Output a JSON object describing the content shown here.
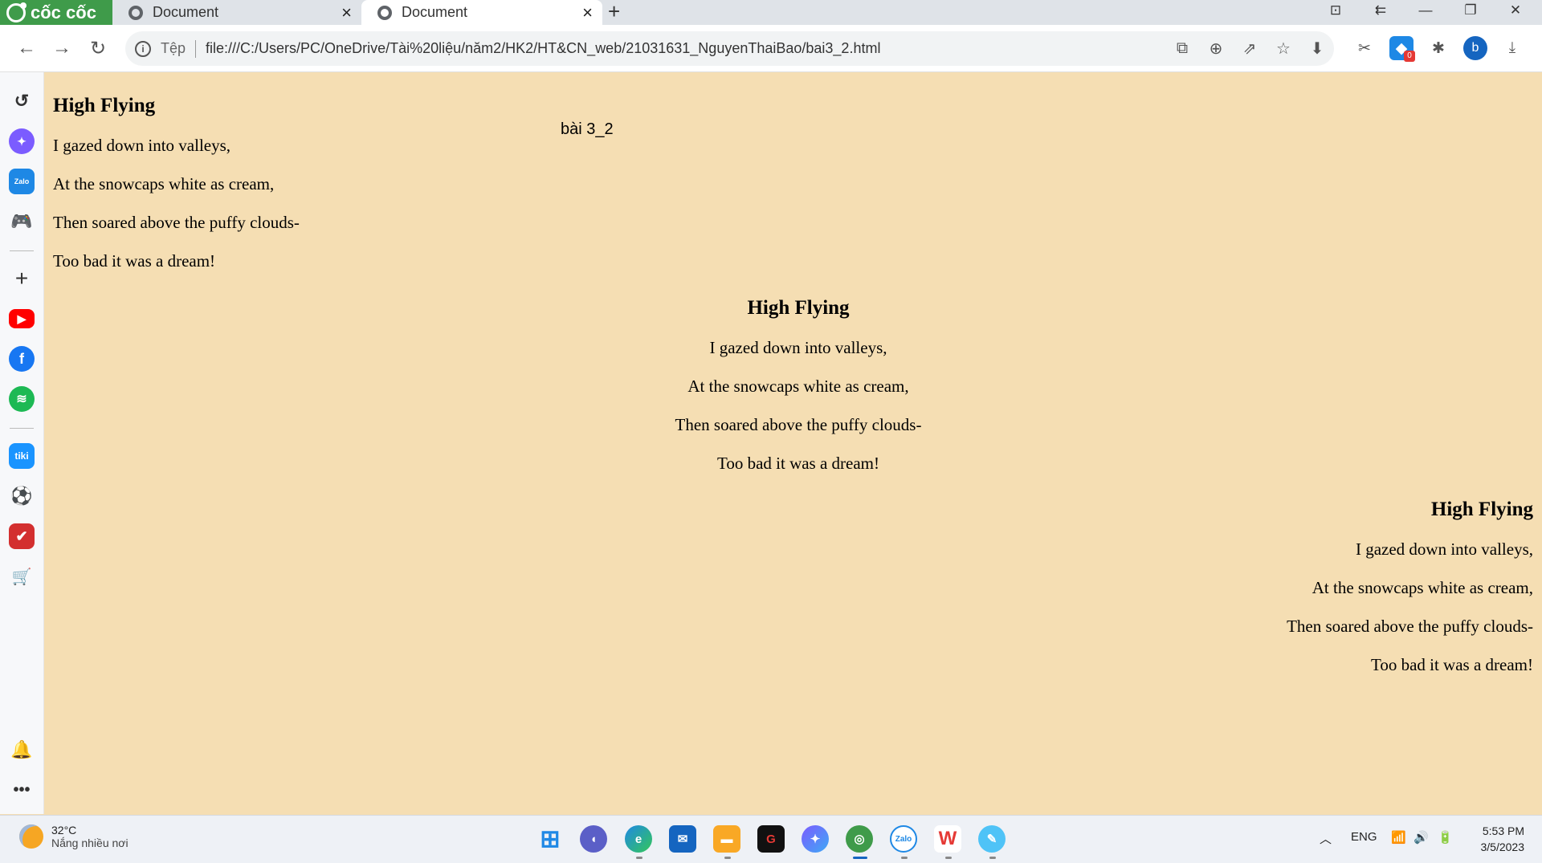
{
  "browser": {
    "brand": "cốc cốc",
    "tabs": [
      {
        "title": "Document"
      },
      {
        "title": "Document"
      }
    ],
    "new_tab_label": "+",
    "address": {
      "scheme_label": "Tệp",
      "url": "file:///C:/Users/PC/OneDrive/Tài%20liệu/năm2/HK2/HT&CN_web/21031631_NguyenThaiBao/bai3_2.html"
    },
    "profile_initial": "b",
    "ext_badge": "0"
  },
  "page": {
    "doc_title": "bài 3_2",
    "poems": [
      {
        "align": "left",
        "heading": "High Flying",
        "lines": [
          "I gazed down into valleys,",
          "At the snowcaps white as cream,",
          "Then soared above the puffy clouds-",
          "Too bad it was a dream!"
        ]
      },
      {
        "align": "center",
        "heading": "High Flying",
        "lines": [
          "I gazed down into valleys,",
          "At the snowcaps white as cream,",
          "Then soared above the puffy clouds-",
          "Too bad it was a dream!"
        ]
      },
      {
        "align": "right",
        "heading": "High Flying",
        "lines": [
          "I gazed down into valleys,",
          "At the snowcaps white as cream,",
          "Then soared above the puffy clouds-",
          "Too bad it was a dream!"
        ]
      }
    ]
  },
  "taskbar": {
    "weather": {
      "temp": "32°C",
      "desc": "Nắng nhiều nơi"
    },
    "language": "ENG",
    "time": "5:53 PM",
    "date": "3/5/2023"
  },
  "colors": {
    "page_bg": "#f5deb3",
    "brand": "#3f9b4a"
  }
}
